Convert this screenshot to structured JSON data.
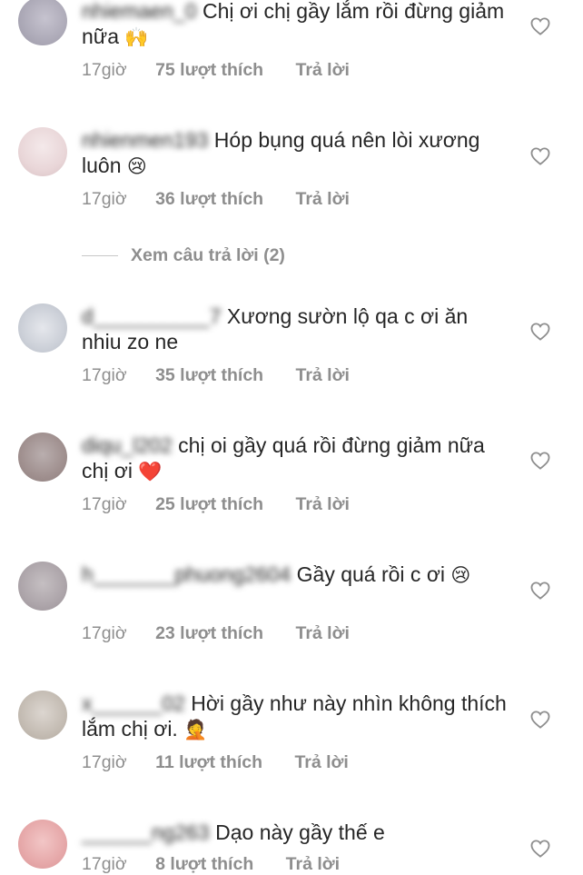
{
  "comments": [
    {
      "username": "nhiemaen_0",
      "text": "Chị ơi chị gầy lắm rồi đừng giảm nữa",
      "emoji": "🙌",
      "time": "17giờ",
      "likes": "75 lượt thích",
      "reply": "Trả lời"
    },
    {
      "username": "nhienmen193",
      "text": "Hóp bụng quá nên lòi xương luôn",
      "emoji": "😢",
      "time": "17giờ",
      "likes": "36 lượt thích",
      "reply": "Trả lời"
    },
    {
      "username": "d__________7",
      "text": "Xương sườn lộ qa c ơi ăn nhiu zo ne",
      "emoji": "",
      "time": "17giờ",
      "likes": "35 lượt thích",
      "reply": "Trả lời"
    },
    {
      "username": "diqu_l202",
      "text": "chị oi gầy quá rồi đừng giảm nữa chị ơi",
      "emoji": "❤️",
      "time": "17giờ",
      "likes": "25 lượt thích",
      "reply": "Trả lời"
    },
    {
      "username": "h_______phuong2604",
      "text": "Gầy quá rồi c ơi",
      "emoji": "😢",
      "time": "17giờ",
      "likes": "23 lượt thích",
      "reply": "Trả lời"
    },
    {
      "username": "x______02",
      "text": "Hời gầy như này nhìn không thích lắm chị ơi.",
      "emoji": "🤦",
      "time": "17giờ",
      "likes": "11 lượt thích",
      "reply": "Trả lời"
    },
    {
      "username": "______ng263",
      "text": "Dạo này gầy thế e",
      "emoji": "",
      "time": "17giờ",
      "likes": "8 lượt thích",
      "reply": "Trả lời"
    }
  ],
  "view_replies": "Xem câu trả lời (2)",
  "icons": {
    "like": "heart-outline-icon"
  },
  "colors": {
    "text": "#262626",
    "meta": "#8e8e8e"
  }
}
